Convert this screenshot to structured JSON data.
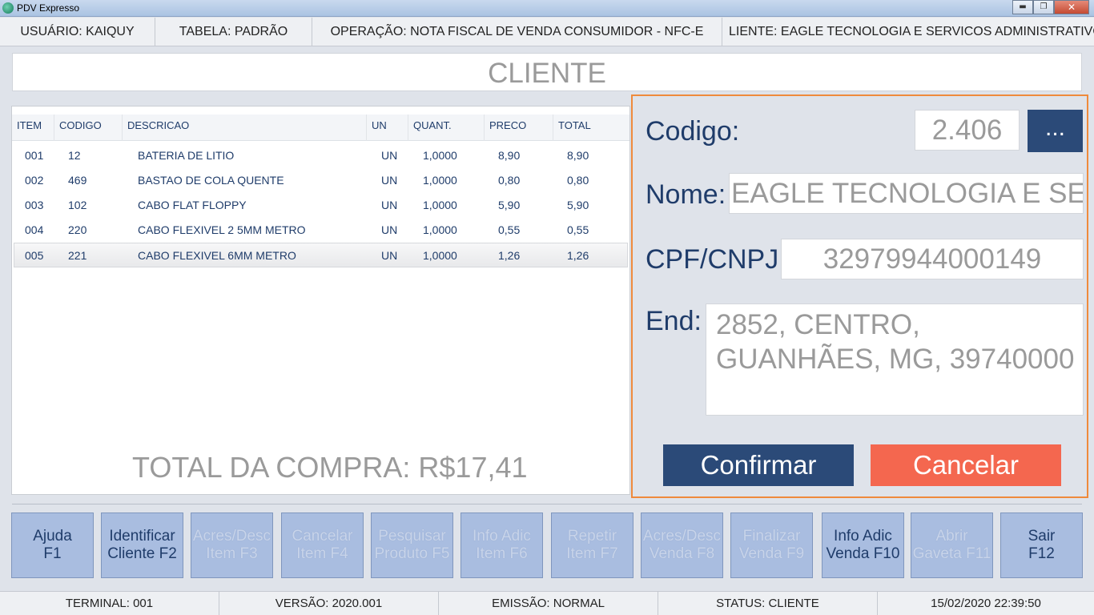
{
  "window": {
    "title": "PDV Expresso",
    "minimize": "▬",
    "maximize": "❐",
    "close": "✕"
  },
  "infobar": {
    "usuario": "USUÁRIO: KAIQUY",
    "tabela": "TABELA: PADRÃO",
    "operacao": "OPERAÇÃO: NOTA FISCAL DE VENDA CONSUMIDOR - NFC-E",
    "cliente": "LIENTE: EAGLE TECNOLOGIA E SERVICOS ADMINISTRATIVOS LTD"
  },
  "header": {
    "title": "CLIENTE"
  },
  "items_table": {
    "columns": [
      "ITEM",
      "CODIGO",
      "DESCRICAO",
      "UN",
      "QUANT.",
      "PRECO",
      "TOTAL"
    ],
    "rows": [
      [
        "001",
        "12",
        "BATERIA DE LITIO",
        "UN",
        "1,0000",
        "8,90",
        "8,90"
      ],
      [
        "002",
        "469",
        "BASTAO DE COLA QUENTE",
        "UN",
        "1,0000",
        "0,80",
        "0,80"
      ],
      [
        "003",
        "102",
        "CABO FLAT FLOPPY",
        "UN",
        "1,0000",
        "5,90",
        "5,90"
      ],
      [
        "004",
        "220",
        "CABO FLEXIVEL 2 5MM METRO",
        "UN",
        "1,0000",
        "0,55",
        "0,55"
      ],
      [
        "005",
        "221",
        "CABO FLEXIVEL 6MM METRO",
        "UN",
        "1,0000",
        "1,26",
        "1,26"
      ]
    ],
    "selected_row": 4
  },
  "total": "TOTAL DA COMPRA: R$17,41",
  "client_form": {
    "codigo_label": "Codigo:",
    "codigo_value": "2.406",
    "lookup_label": "...",
    "nome_label": "Nome:",
    "nome_value": "EAGLE TECNOLOGIA E SERVICOS ADMINISTRATIVOS LTDA",
    "cpf_label": "CPF/CNPJ:",
    "cpf_value": "32979944000149",
    "end_label": "End:",
    "end_value": "2852, CENTRO, GUANHÃES, MG, 39740000",
    "confirm": "Confirmar",
    "cancel": "Cancelar"
  },
  "function_keys": [
    {
      "line1": "Ajuda",
      "line2": "F1",
      "enabled": true
    },
    {
      "line1": "Identificar",
      "line2": "Cliente F2",
      "enabled": true
    },
    {
      "line1": "Acres/Desc",
      "line2": "Item F3",
      "enabled": false
    },
    {
      "line1": "Cancelar",
      "line2": "Item F4",
      "enabled": false
    },
    {
      "line1": "Pesquisar",
      "line2": "Produto F5",
      "enabled": false
    },
    {
      "line1": "Info Adic",
      "line2": "Item F6",
      "enabled": false
    },
    {
      "line1": "Repetir",
      "line2": "Item F7",
      "enabled": false
    },
    {
      "line1": "Acres/Desc",
      "line2": "Venda F8",
      "enabled": false
    },
    {
      "line1": "Finalizar",
      "line2": "Venda F9",
      "enabled": false
    },
    {
      "line1": "Info Adic",
      "line2": "Venda F10",
      "enabled": true
    },
    {
      "line1": "Abrir",
      "line2": "Gaveta F11",
      "enabled": false
    },
    {
      "line1": "Sair",
      "line2": "F12",
      "enabled": true
    }
  ],
  "statusbar": {
    "terminal": "TERMINAL: 001",
    "versao": "VERSÃO: 2020.001",
    "emissao": "EMISSÃO: NORMAL",
    "status": "STATUS: CLIENTE",
    "datetime": "15/02/2020 22:39:50"
  }
}
